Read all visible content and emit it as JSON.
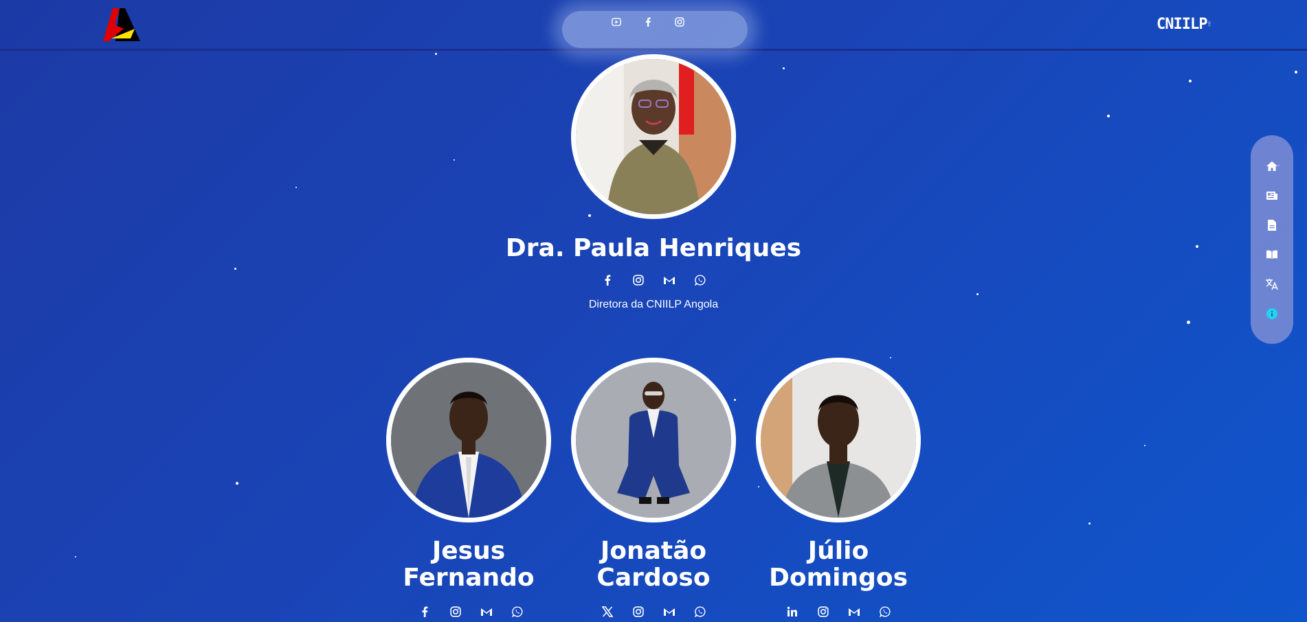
{
  "header": {
    "social_icons": [
      "youtube-icon",
      "facebook-icon",
      "instagram-icon"
    ],
    "logo_right_text": "CNIILP"
  },
  "side_nav": {
    "items": [
      "home-icon",
      "news-icon",
      "document-icon",
      "book-icon",
      "translate-icon",
      "info-icon"
    ]
  },
  "director": {
    "name": "Dra. Paula Henriques",
    "role": "Diretora da CNIILP Angola",
    "social_icons": [
      "facebook-icon",
      "instagram-icon",
      "gmail-icon",
      "whatsapp-icon"
    ]
  },
  "team": [
    {
      "name_line1": "Jesus",
      "name_line2": "Fernando",
      "social_icons": [
        "facebook-icon",
        "instagram-icon",
        "gmail-icon",
        "whatsapp-icon"
      ]
    },
    {
      "name_line1": "Jonatão",
      "name_line2": "Cardoso",
      "social_icons": [
        "x-icon",
        "instagram-icon",
        "gmail-icon",
        "whatsapp-icon"
      ]
    },
    {
      "name_line1": "Júlio",
      "name_line2": "Domingos",
      "social_icons": [
        "linkedin-icon",
        "instagram-icon",
        "gmail-icon",
        "whatsapp-icon"
      ]
    }
  ],
  "colors": {
    "background": "#1a44b6",
    "info_accent": "#22d3ee",
    "logo_red": "#e10000",
    "logo_yellow": "#ffe100"
  }
}
